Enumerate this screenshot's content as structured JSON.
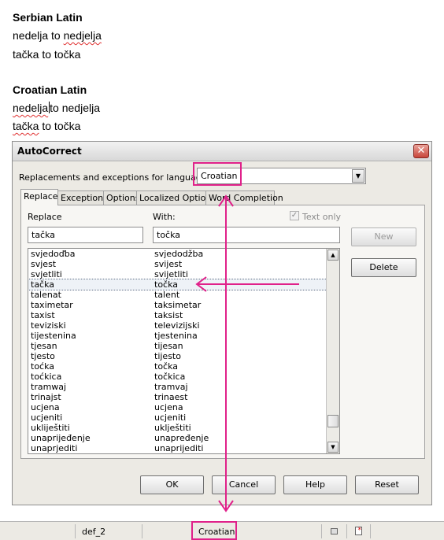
{
  "document": {
    "heading1": "Serbian Latin",
    "line1_word": "nedelja",
    "line1_mid": " to ",
    "line1_word2": "nedjelja",
    "line2": "tačka to točka",
    "heading2": "Croatian Latin",
    "line3_word": "nedelja",
    "line3_rest": "to nedjelja",
    "line4_word": "tačka",
    "line4_rest": " to točka"
  },
  "dialog": {
    "title": "AutoCorrect",
    "close_glyph": "✕",
    "language_label": "Replacements and exceptions for language:",
    "language_value": "Croatian",
    "tabs": [
      "Replace",
      "Exceptions",
      "Options",
      "Localized Options",
      "Word Completion"
    ],
    "replace_header": "Replace",
    "with_header": "With:",
    "text_only_label": "Text only",
    "replace_value": "tačka",
    "with_value": "točka",
    "list": [
      {
        "replace": "svjedoďba",
        "with": "svjedodžba"
      },
      {
        "replace": "svjest",
        "with": "svijest"
      },
      {
        "replace": "svjetliti",
        "with": "svijetliti"
      },
      {
        "replace": "tačka",
        "with": "točka"
      },
      {
        "replace": "talenat",
        "with": "talent"
      },
      {
        "replace": "taximetar",
        "with": "taksimetar"
      },
      {
        "replace": "taxist",
        "with": "taksist"
      },
      {
        "replace": "teviziski",
        "with": "televizijski"
      },
      {
        "replace": "tijestenina",
        "with": "tjestenina"
      },
      {
        "replace": "tjesan",
        "with": "tijesan"
      },
      {
        "replace": "tjesto",
        "with": "tijesto"
      },
      {
        "replace": "toćka",
        "with": "točka"
      },
      {
        "replace": "toćkica",
        "with": "točkica"
      },
      {
        "replace": "tramwaj",
        "with": "tramvaj"
      },
      {
        "replace": "trinajst",
        "with": "trinaest"
      },
      {
        "replace": "ucjena",
        "with": "ucjena"
      },
      {
        "replace": "ucjeniti",
        "with": "ucjeniti"
      },
      {
        "replace": "ukliještiti",
        "with": "uklještiti"
      },
      {
        "replace": "unaprijeđenje",
        "with": "unapređenje"
      },
      {
        "replace": "unaprjediti",
        "with": "unaprijediti"
      }
    ],
    "new_label": "New",
    "delete_label": "Delete",
    "ok_label": "OK",
    "cancel_label": "Cancel",
    "help_label": "Help",
    "reset_label": "Reset"
  },
  "status_bar": {
    "page_style": "def_2",
    "language": "Croatian"
  },
  "colors": {
    "annotation": "#e0218a",
    "spell_underline": "#e03030"
  }
}
